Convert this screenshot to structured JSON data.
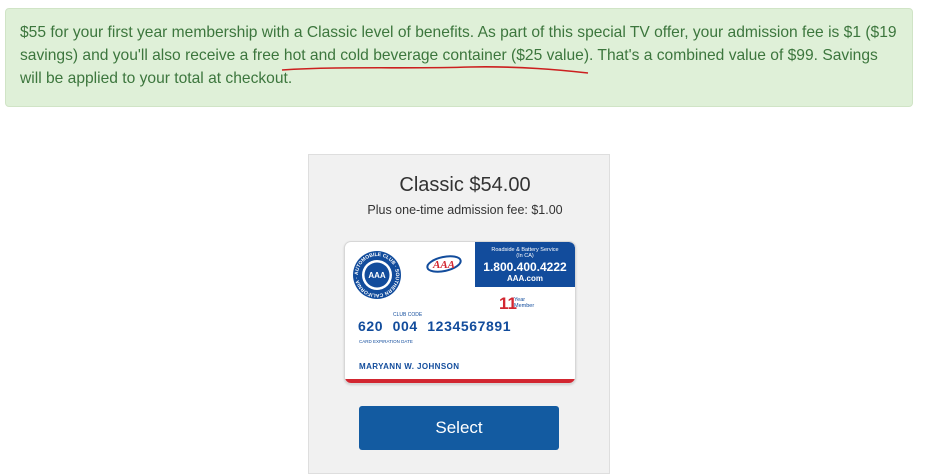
{
  "promo": {
    "text_before": "$55 for your first year membership with a Classic level of benefits. As part of this special TV offer, your admission fee is $1 ($19 savings) and you'll also receive a free ",
    "highlight": "hot and cold beverage container ($25 value)",
    "text_after": ". That's a combined value of $99. Savings will be applied to your total at checkout.",
    "annotation_color": "#cc1f1f"
  },
  "plan": {
    "title": "Classic $54.00",
    "subtitle": "Plus one-time admission fee: $1.00"
  },
  "card": {
    "seal_text": "AUTOMOBILE CLUB · SOUTHERN CALIFORNIA ·",
    "seal_center": "AAA",
    "logo_text": "AAA",
    "service_label": "Roadside & Battery Service",
    "service_region": "(In CA)",
    "phone": "1.800.400.4222",
    "website": "AAA.com",
    "years": "11",
    "years_label_1": "Year",
    "years_label_2": "Member",
    "club_code_label": "CLUB CODE",
    "number": "620 004 1234567891",
    "expiration_label": "CARD EXPIRATION DATE",
    "member_name": "MARYANN W. JOHNSON",
    "colors": {
      "blue": "#124c9c",
      "red": "#d22630"
    }
  },
  "select_button": {
    "label": "Select"
  },
  "colors": {
    "notice_bg": "#dff0d8",
    "notice_text": "#3c763d",
    "panel_bg": "#f1f1f1",
    "button_bg": "#135ba1"
  }
}
